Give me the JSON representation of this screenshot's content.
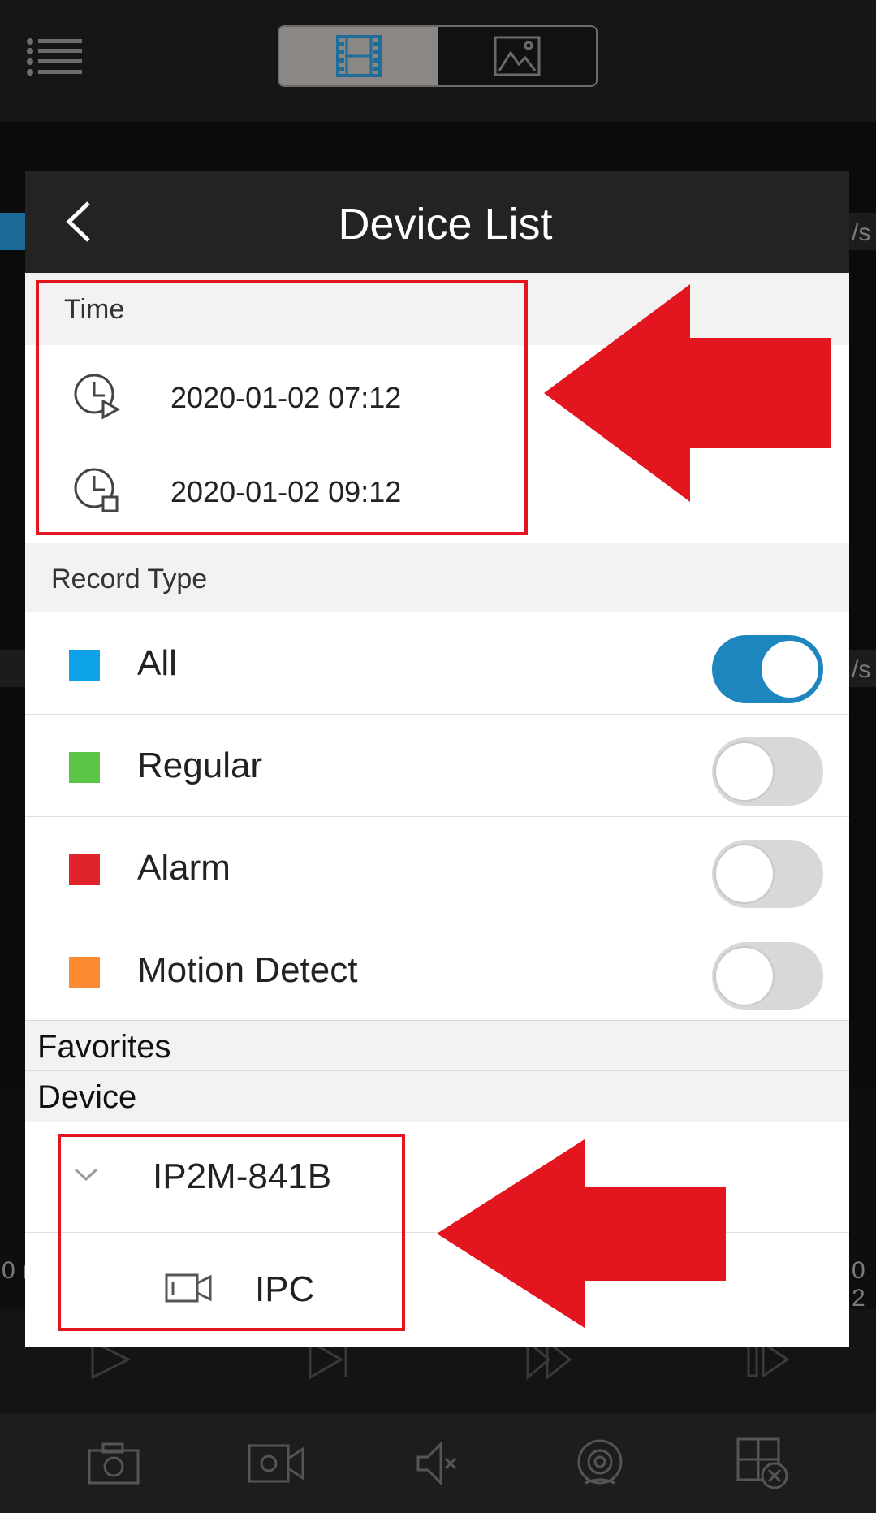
{
  "background": {
    "menu_icon": "list-menu-icon",
    "segments": [
      {
        "icon": "video-film-icon",
        "active": true
      },
      {
        "icon": "image-icon",
        "active": false
      }
    ],
    "rate_fragment_top": "/s",
    "rate_fragment_mid": "/s",
    "timeline_left_fragment": "0 (",
    "timeline_right_fragment": "0 2",
    "playback_controls": [
      "play-icon",
      "step-forward-icon",
      "fast-forward-icon",
      "next-frame-icon"
    ],
    "bottom_toolbar": [
      "camera-snapshot-icon",
      "record-video-icon",
      "mute-icon",
      "fisheye-icon",
      "close-window-icon"
    ]
  },
  "panel": {
    "title": "Device List",
    "time_section": {
      "label": "Time",
      "start": "2020-01-02 07:12",
      "end": "2020-01-02 09:12"
    },
    "record_type_section": {
      "label": "Record Type",
      "items": [
        {
          "label": "All",
          "color": "#0ea2e8",
          "enabled": true
        },
        {
          "label": "Regular",
          "color": "#5cc547",
          "enabled": false
        },
        {
          "label": "Alarm",
          "color": "#e0242c",
          "enabled": false
        },
        {
          "label": "Motion Detect",
          "color": "#fb8a33",
          "enabled": false
        }
      ]
    },
    "favorites_label": "Favorites",
    "device_label": "Device",
    "device": {
      "name": "IP2M-841B",
      "channel": "IPC"
    }
  },
  "colors": {
    "accent": "#1e86bf",
    "annotation_red": "#e3161f"
  }
}
